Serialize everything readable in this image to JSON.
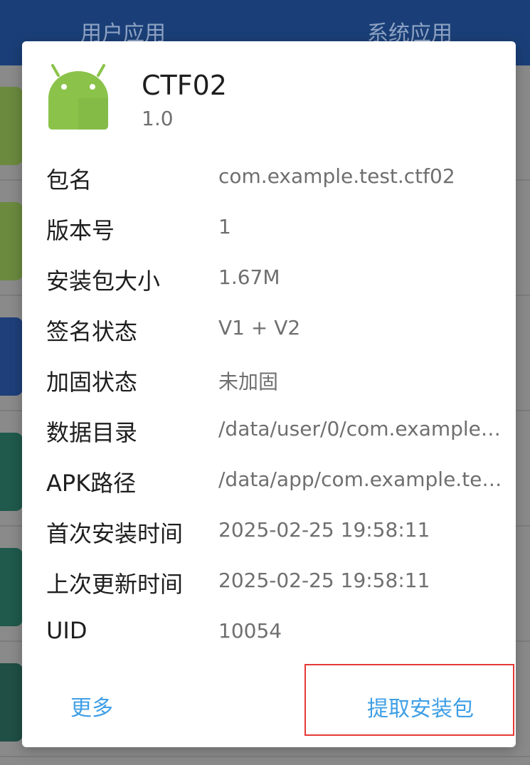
{
  "tabs": {
    "user_apps": "用户应用",
    "system_apps": "系统应用"
  },
  "dialog": {
    "app_name": "CTF02",
    "app_version": "1.0",
    "icon": "android-robot-icon",
    "rows": [
      {
        "label": "包名",
        "value": "com.example.test.ctf02"
      },
      {
        "label": "版本号",
        "value": "1"
      },
      {
        "label": "安装包大小",
        "value": "1.67M"
      },
      {
        "label": "签名状态",
        "value": "V1 + V2"
      },
      {
        "label": "加固状态",
        "value": "未加固"
      },
      {
        "label": "数据目录",
        "value": "/data/user/0/com.example…"
      },
      {
        "label": "APK路径",
        "value": "/data/app/com.example.te…"
      },
      {
        "label": "首次安装时间",
        "value": "2025-02-25 19:58:11"
      },
      {
        "label": "上次更新时间",
        "value": "2025-02-25 19:58:11"
      },
      {
        "label": "UID",
        "value": "10054"
      }
    ],
    "more_button": "更多",
    "extract_button": "提取安装包"
  },
  "colors": {
    "tabbar": "#1a3f78",
    "link": "#3f9fe6",
    "highlight_border": "#e53935",
    "android_green": "#8bc34a"
  }
}
